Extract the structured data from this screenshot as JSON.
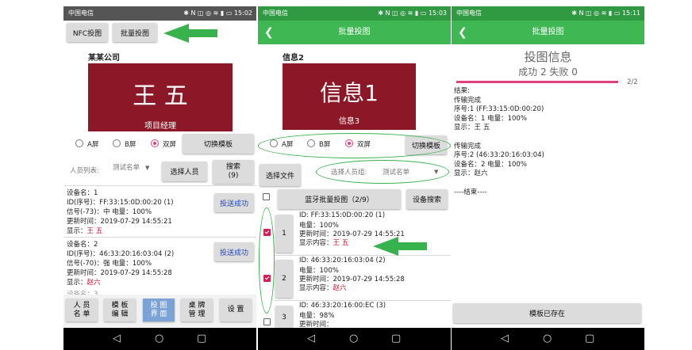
{
  "status_bar": {
    "carrier": "中国电信",
    "icons": "✱ N ◫ ◎ ≋ ▮ ▭",
    "times": [
      "15:02",
      "15:03",
      "15:11"
    ]
  },
  "screen1": {
    "nfc_button": "NFC投图",
    "batch_button": "批量投图",
    "company": "某某公司",
    "badge_name": "王 五",
    "badge_title": "项目经理",
    "radios": [
      "A屏",
      "B屏",
      "双屏"
    ],
    "switch_template": "切换模板",
    "person_list_label": "人员列表:",
    "person_list_value": "测试名单",
    "select_person": "选择人员",
    "search_label": "搜索",
    "search_count": "(9)",
    "devices": [
      {
        "name": "设备名：1",
        "id": "ID(序号)：FF:33:15:0D:00:20 (1)",
        "signal": "信号(-73)：中    电量：100%",
        "update": "更新时间：2019-07-29 14:55:21",
        "display_label": "显示：",
        "display_value": "王 五",
        "status": "投送成功"
      },
      {
        "name": "设备名：2",
        "id": "ID(序号)：46:33:20:16:03:04 (2)",
        "signal": "信号(-70)：强    电量：100%",
        "update": "更新时间：2019-07-29 14:55:28",
        "display_label": "显示：",
        "display_value": "赵六",
        "status": "投送成功"
      }
    ],
    "partial_row": "设备名：3",
    "tabs": [
      {
        "line1": "人 员",
        "line2": "名 单"
      },
      {
        "line1": "模 板",
        "line2": "编 辑"
      },
      {
        "line1": "投 图",
        "line2": "界 面"
      },
      {
        "line1": "桌 牌",
        "line2": "管 理"
      },
      {
        "line1": "设 置",
        "line2": ""
      }
    ]
  },
  "screen2": {
    "title": "批量投图",
    "label": "信息2",
    "badge_main": "信息1",
    "badge_sub": "信息3",
    "radios": [
      "A屏",
      "B屏",
      "双屏"
    ],
    "switch_template": "切换模板",
    "select_file": "选择文件",
    "group_label": "选择人员组:",
    "group_value": "测试名单",
    "bluetooth_button": "蓝牙批量投图（2/9）",
    "device_search": "设备搜索",
    "items": [
      {
        "index": "1",
        "id": "ID: FF:33:15:0D:00:20 (1)",
        "battery": "电量：100%",
        "update": "更新时间：2019-07-29 14:55:21",
        "content_label": "显示内容：",
        "content_value": "王 五",
        "checked": true
      },
      {
        "index": "2",
        "id": "ID: 46:33:20:16:03:04 (2)",
        "battery": "电量：100%",
        "update": "更新时间：2019-07-29 14:55:28",
        "content_label": "显示内容：",
        "content_value": "赵六",
        "checked": true
      },
      {
        "index": "3",
        "id": "ID: 46:33:20:16:00:EC (3)",
        "battery": "电量：98%",
        "update": "更新时间：",
        "content_label": "",
        "content_value": "",
        "checked": false
      }
    ]
  },
  "screen3": {
    "title": "批量投图",
    "heading": "投图信息",
    "success_fail": "成功 2  失败 0",
    "progress_text": "2/2",
    "progress": 1.0,
    "result_lines": [
      "结果:",
      "传输完成",
      "序号:1 (FF:33:15:0D:00:20)",
      "设备名：1 电量：100%",
      "显示：王 五",
      "",
      "传输完成",
      "序号:2 (46:33:20:16:03:04)",
      "设备名：2 电量：100%",
      "显示：赵六",
      "",
      "----结束----"
    ],
    "template_exists": "模板已存在"
  },
  "colors": {
    "accent_green": "#3fb753",
    "badge_red": "#8c1827",
    "radio_pink": "#e0407e",
    "tab_active": "#7ba3d6"
  }
}
